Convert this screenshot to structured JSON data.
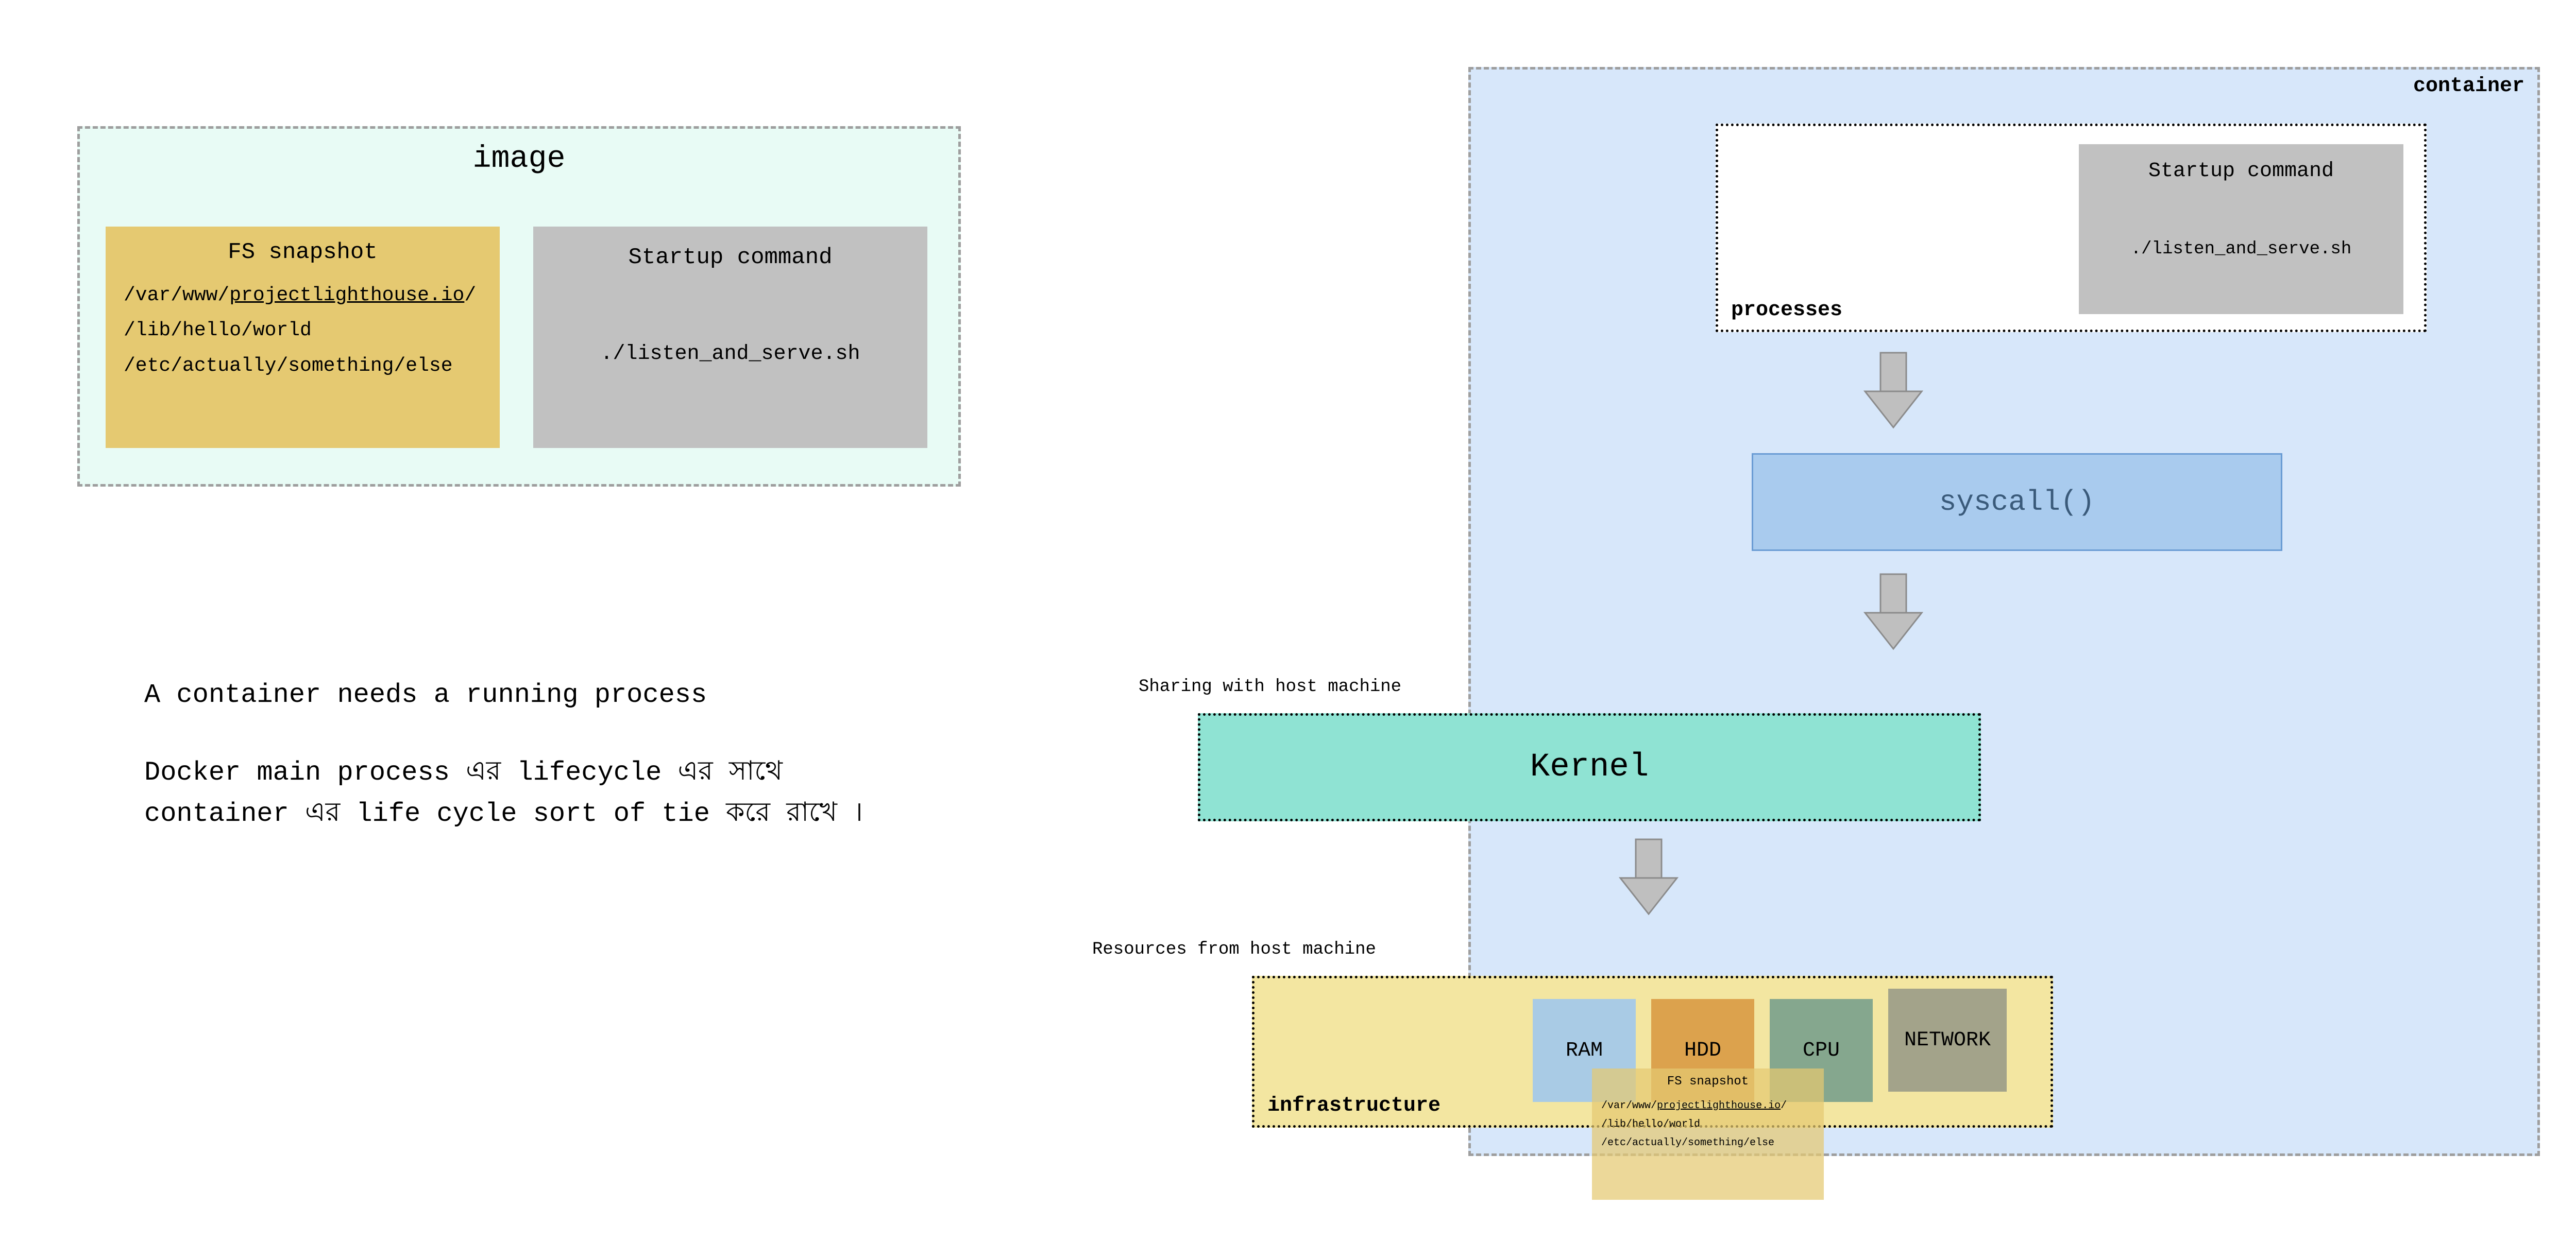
{
  "image_box": {
    "title": "image",
    "fs": {
      "title": "FS snapshot",
      "paths": [
        "/var/www/",
        "projectlighthouse.io",
        "/",
        "/lib/hello/world",
        "/etc/actually/something/else"
      ]
    },
    "startup": {
      "title": "Startup command",
      "cmd": "./listen_and_serve.sh"
    }
  },
  "text": {
    "line1": "A container needs a running process",
    "para": "Docker main process এর lifecycle এর সাথে container এর life cycle sort of tie করে রাখে ।"
  },
  "container": {
    "label": "container",
    "processes": {
      "label": "processes",
      "startup_title": "Startup command",
      "startup_cmd": "./listen_and_serve.sh"
    },
    "syscall": "syscall()",
    "kernel_caption": "Sharing with host machine",
    "kernel": "Kernel",
    "infra_caption": "Resources from host machine",
    "infra": {
      "label": "infrastructure",
      "items": [
        "RAM",
        "HDD",
        "CPU",
        "NETWORK"
      ]
    },
    "fs_overlay": {
      "title": "FS snapshot",
      "paths": [
        "/var/www/",
        "projectlighthouse.io",
        "/",
        "/lib/hello/world",
        "/etc/actually/something/else"
      ]
    }
  },
  "colors": {
    "mint": "#e8fbf5",
    "yellow": "#e5c971",
    "grey": "#c1c1c1",
    "blue_light": "#d7e7fa",
    "blue_mid": "#a9cbee",
    "teal": "#8fe3d3",
    "pale_yellow": "#f3e6a1",
    "pale_blue": "#a9cbe5",
    "orange": "#dca24d",
    "green": "#85a78e",
    "olive": "#a3a38a",
    "arrow": "#bfbfbf",
    "overlay": "rgba(229,201,113,0.7)"
  }
}
